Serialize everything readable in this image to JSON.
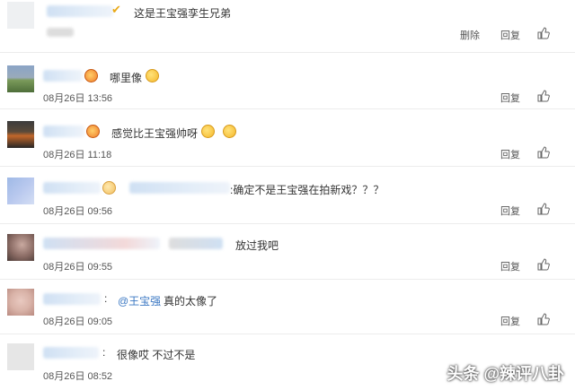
{
  "comments": [
    {
      "text": "这是王宝强孪生兄弟",
      "time": "",
      "actions": [
        "删除",
        "回复"
      ],
      "avatar_colors": [
        "#e8ecef",
        "#e8ecef",
        "#e8ecef"
      ]
    },
    {
      "text": "哪里像",
      "time": "08月26日 13:56",
      "actions": [
        "回复"
      ],
      "avatar_colors": [
        "#8aa4c6",
        "#7a9a5a",
        "#4e6e3a"
      ]
    },
    {
      "text": "感觉比王宝强帅呀",
      "time": "08月26日 11:18",
      "actions": [
        "回复"
      ],
      "avatar_colors": [
        "#3c3c3c",
        "#c2672a",
        "#262626"
      ]
    },
    {
      "text": ":确定不是王宝强在拍新戏？？？",
      "time": "08月26日 09:56",
      "actions": [
        "回复"
      ],
      "avatar_colors": [
        "#9fb9e6",
        "#b8c8ee",
        "#d4def4"
      ]
    },
    {
      "text": "放过我吧",
      "time": "08月26日 09:55",
      "actions": [
        "回复"
      ],
      "avatar_colors": [
        "#8a6b64",
        "#c9a9a0",
        "#4a3a36"
      ]
    },
    {
      "mention": "@王宝强",
      "text": "真的太像了",
      "time": "08月26日 09:05",
      "actions": [
        "回复"
      ],
      "avatar_colors": [
        "#d9b3a8",
        "#e9c9c0",
        "#b98a80"
      ]
    },
    {
      "text": "很像哎 不过不是",
      "time": "08月26日 08:52",
      "actions": [],
      "avatar_colors": [
        "#e6e6e6",
        "#d8d8d8",
        "#ececec"
      ]
    }
  ],
  "watermark": "头条 @辣评八卦"
}
